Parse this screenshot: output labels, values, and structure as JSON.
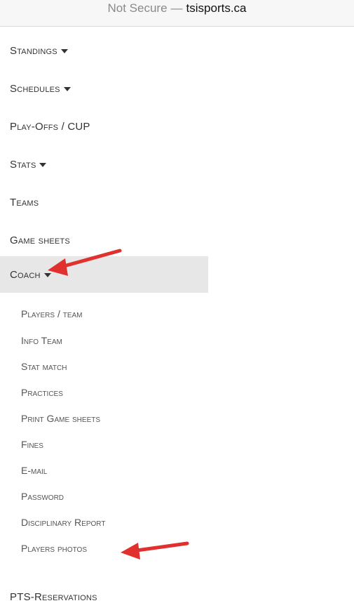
{
  "browser": {
    "security_label": "Not Secure",
    "separator": "—",
    "domain": "tsisports.ca"
  },
  "menu": {
    "items": [
      {
        "label": "Standings",
        "has_caret": true
      },
      {
        "label": "Schedules",
        "has_caret": true
      },
      {
        "label": "Play-Offs / CUP",
        "has_caret": false
      },
      {
        "label": "Stats",
        "has_caret": true
      },
      {
        "label": "Teams",
        "has_caret": false
      },
      {
        "label": "Game sheets",
        "has_caret": false
      },
      {
        "label": "Coach",
        "has_caret": true,
        "active": true
      }
    ],
    "coach_submenu": [
      "Players / team",
      "Info Team",
      "Stat match",
      "Practices",
      "Print Game sheets",
      "Fines",
      "E-mail",
      "Password",
      "Disciplinary Report",
      "Players photos"
    ],
    "after_items": [
      {
        "label": "PTS-Reservations",
        "has_caret": false
      }
    ]
  },
  "annotation": {
    "arrow_color": "#e0312f"
  }
}
